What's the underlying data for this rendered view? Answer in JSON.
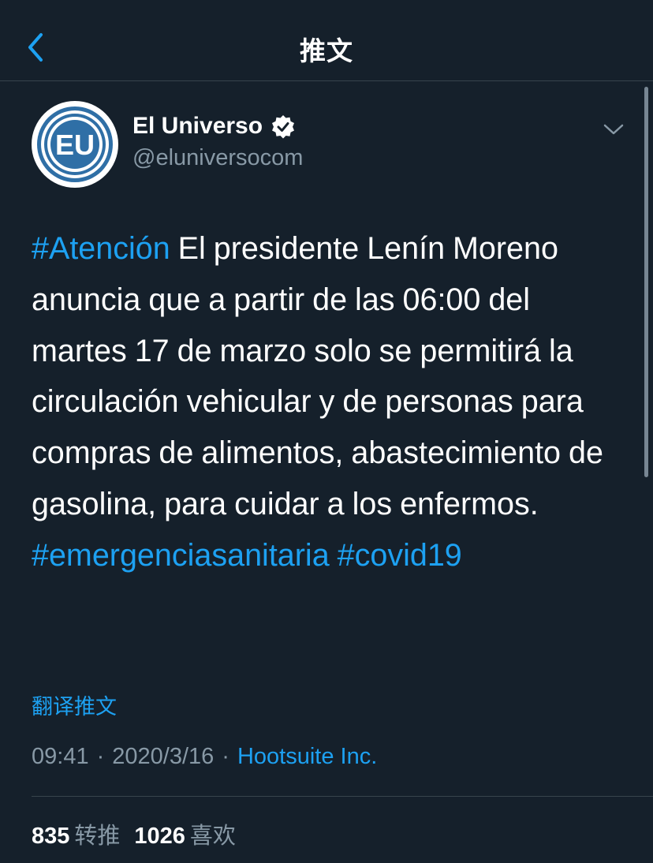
{
  "header": {
    "title": "推文",
    "back_icon": "chevron-left-icon"
  },
  "author": {
    "name": "El Universo",
    "handle": "@eluniversocom",
    "avatar_text": "EU",
    "verified": true
  },
  "tweet": {
    "segments": [
      {
        "text": "#Atención",
        "type": "hashtag"
      },
      {
        "text": " El presidente Lenín Moreno anuncia que a partir de las 06:00 del martes 17 de marzo solo se permitirá la circulación vehicular y de personas para compras de alimentos, abastecimiento de gasolina, para cuidar a los enfermos. ",
        "type": "text"
      },
      {
        "text": "#emergenciasanitaria",
        "type": "hashtag"
      },
      {
        "text": " ",
        "type": "text"
      },
      {
        "text": "#covid19",
        "type": "hashtag"
      }
    ],
    "translate_label": "翻译推文",
    "time": "09:41",
    "date": "2020/3/16",
    "separator": "·",
    "source": "Hootsuite Inc."
  },
  "stats": {
    "retweets_count": "835",
    "retweets_label": "转推",
    "likes_count": "1026",
    "likes_label": "喜欢"
  },
  "colors": {
    "background": "#15202b",
    "accent": "#1da1f2",
    "secondary_text": "#8899a6",
    "border": "#38444d"
  }
}
